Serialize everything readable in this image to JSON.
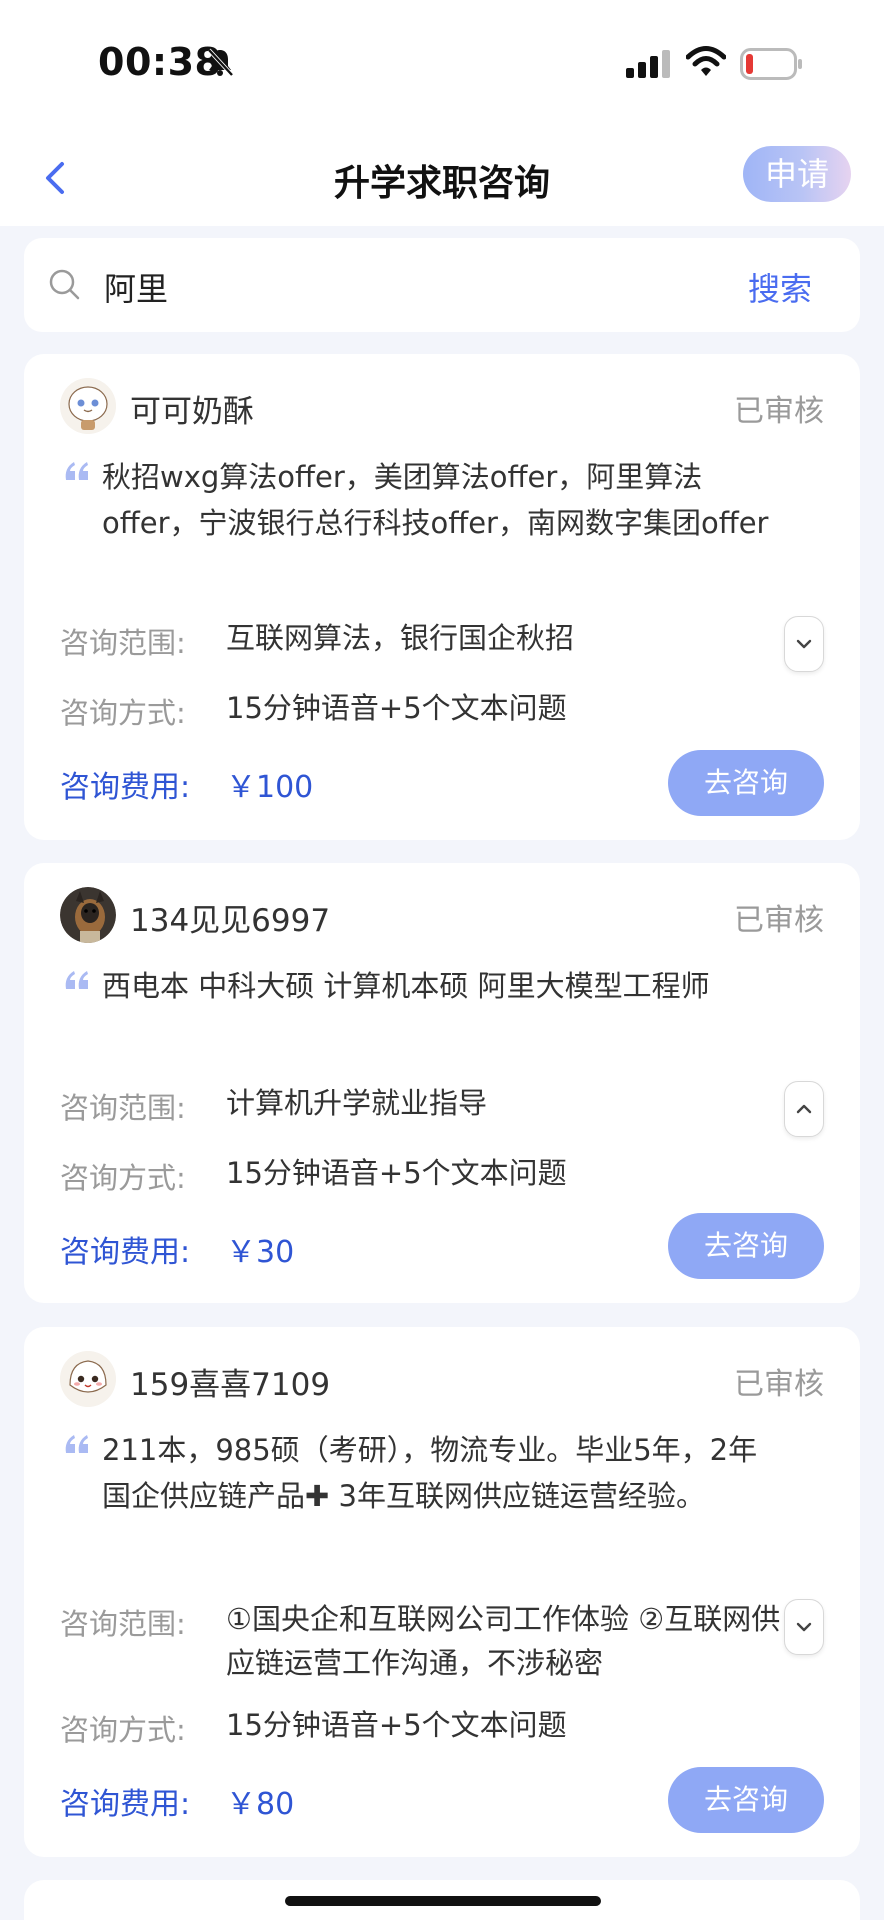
{
  "status_bar": {
    "time": "00:38"
  },
  "header": {
    "title": "升学求职咨询",
    "apply_label": "申请"
  },
  "search": {
    "query": "阿里",
    "button_label": "搜索"
  },
  "labels": {
    "scope": "咨询范围:",
    "method": "咨询方式:",
    "fee": "咨询费用:",
    "consult_button": "去咨询"
  },
  "cards": [
    {
      "username": "可可奶酥",
      "status": "已审核",
      "description": "秋招wxg算法offer，美团算法offer，阿里算法offer，宁波银行总行科技offer，南网数字集团offer",
      "scope": "互联网算法，银行国企秋招",
      "method": "15分钟语音+5个文本问题",
      "fee": "￥100",
      "toggle": "chevron-down-icon"
    },
    {
      "username": "134见见6997",
      "status": "已审核",
      "description": "西电本 中科大硕 计算机本硕 阿里大模型工程师",
      "scope": "计算机升学就业指导",
      "method": "15分钟语音+5个文本问题",
      "fee": "￥30",
      "toggle": "chevron-up-icon"
    },
    {
      "username": "159喜喜7109",
      "status": "已审核",
      "description": "211本，985硕（考研），物流专业。毕业5年，2年国企供应链产品✚ 3年互联网供应链运营经验。",
      "scope": "①国央企和互联网公司工作体验 ②互联网供应链运营工作沟通，不涉秘密",
      "method": "15分钟语音+5个文本问题",
      "fee": "￥80",
      "toggle": "chevron-down-icon"
    }
  ],
  "colors": {
    "accent": "#2f55d4",
    "button": "#8fa8f5",
    "background": "#f3f5fb"
  }
}
